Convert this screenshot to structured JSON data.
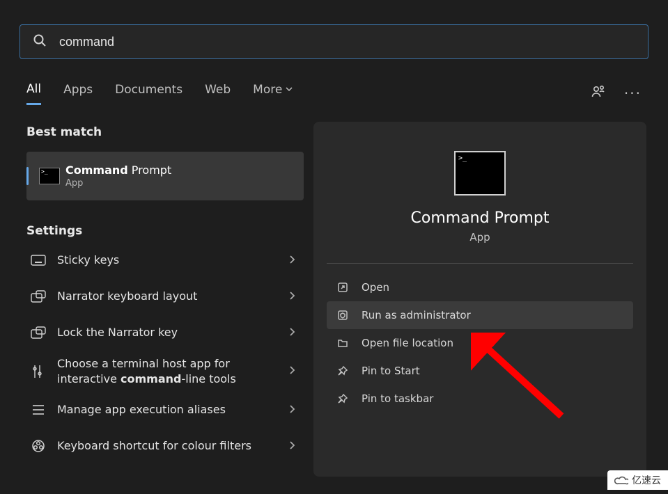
{
  "search": {
    "query": "command"
  },
  "tabs": {
    "all": "All",
    "apps": "Apps",
    "documents": "Documents",
    "web": "Web",
    "more": "More"
  },
  "sections": {
    "best_match": "Best match",
    "settings": "Settings"
  },
  "best_match": {
    "title_bold": "Command",
    "title_rest": " Prompt",
    "subtitle": "App"
  },
  "settings_items": [
    {
      "label_html": "Sticky keys",
      "icon": "keyboard"
    },
    {
      "label_html": "Narrator keyboard layout",
      "icon": "narrator-kb"
    },
    {
      "label_html": "Lock the Narrator key",
      "icon": "narrator-lock"
    },
    {
      "label_html": "Choose a terminal host app for interactive <b class='bold'>command</b>-line tools",
      "icon": "terminal-host"
    },
    {
      "label_html": "Manage app execution aliases",
      "icon": "aliases"
    },
    {
      "label_html": "Keyboard shortcut for colour filters",
      "icon": "colour-filter"
    }
  ],
  "preview": {
    "title": "Command Prompt",
    "subtitle": "App"
  },
  "actions": {
    "open": "Open",
    "run_admin": "Run as administrator",
    "open_location": "Open file location",
    "pin_start": "Pin to Start",
    "pin_taskbar": "Pin to taskbar"
  },
  "watermark": "亿速云"
}
